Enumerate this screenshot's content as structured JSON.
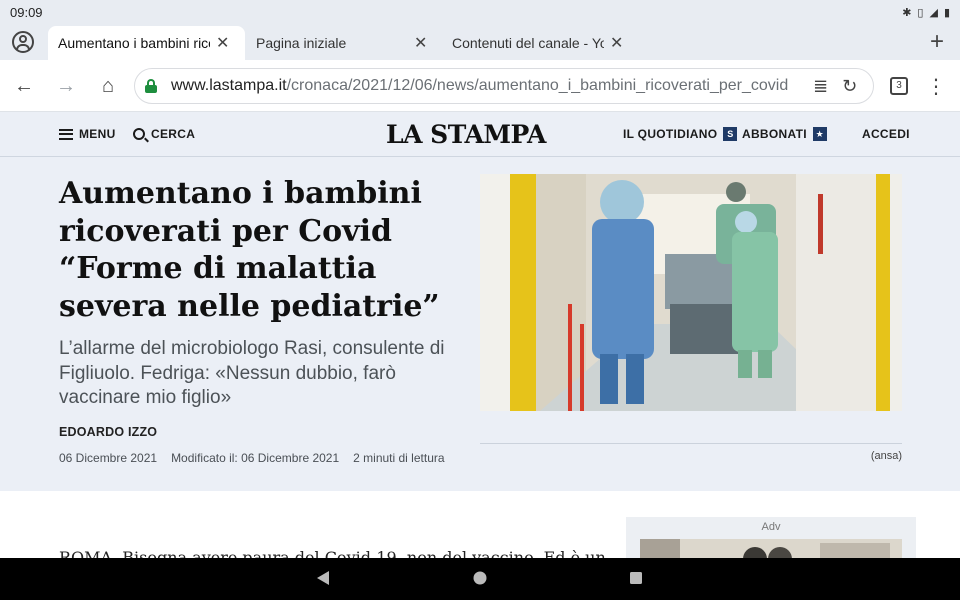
{
  "status_bar": {
    "time": "09:09"
  },
  "browser": {
    "tabs": [
      {
        "title": "Aumentano i bambini ricoverati per Covid",
        "active": true
      },
      {
        "title": "Pagina iniziale",
        "active": false
      },
      {
        "title": "Contenuti del canale - YouTube",
        "active": false
      }
    ],
    "url_host": "www.lastampa.it",
    "url_path": "/cronaca/2021/12/06/news/aumentano_i_bambini_ricoverati_per_covid",
    "tab_count": "3"
  },
  "site_header": {
    "menu_label": "MENU",
    "search_label": "CERCA",
    "logo": "LA STAMPA",
    "quotidiano_label": "IL QUOTIDIANO",
    "abbonati_label": "ABBONATI",
    "accedi_label": "ACCEDI"
  },
  "article": {
    "headline": "Aumentano i bambini ricoverati per Covid “Forme di malattia severa nelle pediatrie”",
    "subtitle": "L’allarme del microbiologo Rasi, consulente di Figliuolo. Fedriga: «Nessun dubbio, farò vaccinare mio figlio»",
    "author": "EDOARDO IZZO",
    "date": "06 Dicembre 2021",
    "modified": "Modificato il: 06 Dicembre 2021",
    "read_time": "2 minuti di lettura",
    "photo_credit": "(ansa)",
    "body_start": "ROMA. Bisogna avere paura del Covid-19, non del vaccino. Ed è un"
  },
  "ad": {
    "label": "Adv"
  },
  "colors": {
    "header_bg": "#ebeff6",
    "accent_lock": "#1e8e3e",
    "badge_blue": "#1f3a66"
  }
}
